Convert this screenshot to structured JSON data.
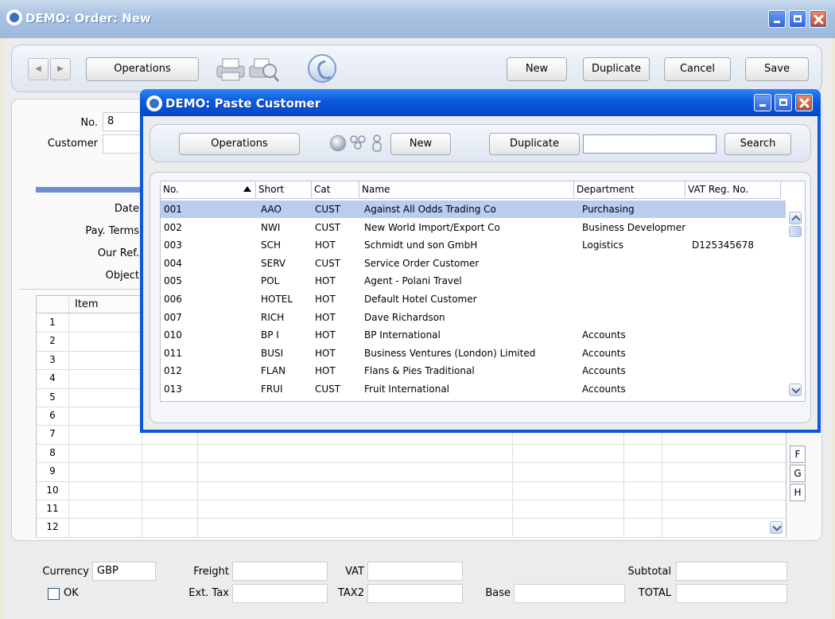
{
  "main_window": {
    "title": "DEMO: Order: New",
    "toolbar": {
      "operations": "Operations",
      "new": "New",
      "duplicate": "Duplicate",
      "cancel": "Cancel",
      "save": "Save"
    },
    "header_fields": {
      "no_label": "No.",
      "no_value": "8",
      "customer_label": "Customer",
      "customer_value": "",
      "date_label": "Date",
      "pay_terms_label": "Pay. Terms",
      "our_ref_label": "Our Ref.",
      "object_label": "Object"
    },
    "grid": {
      "item_header": "Item",
      "row_numbers": [
        "1",
        "2",
        "3",
        "4",
        "5",
        "6",
        "7",
        "8",
        "9",
        "10",
        "11",
        "12"
      ],
      "side_tabs": [
        "F",
        "G",
        "H"
      ]
    },
    "footer": {
      "currency_label": "Currency",
      "currency_value": "GBP",
      "ok_label": "OK",
      "freight_label": "Freight",
      "ext_tax_label": "Ext. Tax",
      "vat_label": "VAT",
      "tax2_label": "TAX2",
      "base_label": "Base",
      "subtotal_label": "Subtotal",
      "total_label": "TOTAL"
    }
  },
  "dialog": {
    "title": "DEMO: Paste Customer",
    "toolbar": {
      "operations": "Operations",
      "new": "New",
      "duplicate": "Duplicate",
      "search_value": "",
      "search_button": "Search"
    },
    "columns": [
      "No.",
      "Short",
      "Cat",
      "Name",
      "Department",
      "VAT Reg. No."
    ],
    "sort_column": "Short",
    "rows": [
      {
        "no": "001",
        "short": "AAO",
        "cat": "CUST",
        "name": "Against All Odds Trading Co",
        "department": "Purchasing",
        "vat": ""
      },
      {
        "no": "002",
        "short": "NWI",
        "cat": "CUST",
        "name": "New World Import/Export Co",
        "department": "Business Developmer",
        "vat": ""
      },
      {
        "no": "003",
        "short": "SCH",
        "cat": "HOT",
        "name": "Schmidt und son GmbH",
        "department": "Logistics",
        "vat": "D125345678"
      },
      {
        "no": "004",
        "short": "SERV",
        "cat": "CUST",
        "name": "Service Order Customer",
        "department": "",
        "vat": ""
      },
      {
        "no": "005",
        "short": "POL",
        "cat": "HOT",
        "name": "Agent - Polani Travel",
        "department": "",
        "vat": ""
      },
      {
        "no": "006",
        "short": "HOTEL",
        "cat": "HOT",
        "name": "Default Hotel Customer",
        "department": "",
        "vat": ""
      },
      {
        "no": "007",
        "short": "RICH",
        "cat": "HOT",
        "name": "Dave Richardson",
        "department": "",
        "vat": ""
      },
      {
        "no": "010",
        "short": "BP I",
        "cat": "HOT",
        "name": "BP International",
        "department": "Accounts",
        "vat": ""
      },
      {
        "no": "011",
        "short": "BUSI",
        "cat": "HOT",
        "name": "Business Ventures (London) Limited",
        "department": "Accounts",
        "vat": ""
      },
      {
        "no": "012",
        "short": "FLAN",
        "cat": "HOT",
        "name": "Flans & Pies Traditional",
        "department": "Accounts",
        "vat": ""
      },
      {
        "no": "013",
        "short": "FRUI",
        "cat": "CUST",
        "name": "Fruit International",
        "department": "Accounts",
        "vat": ""
      }
    ],
    "selected_row": "001"
  },
  "colors": {
    "titlebar_active": "#0b59e0",
    "titlebar_inactive": "#a9c2e2",
    "selection": "#b9cdf1",
    "window_bg": "#ececec"
  }
}
